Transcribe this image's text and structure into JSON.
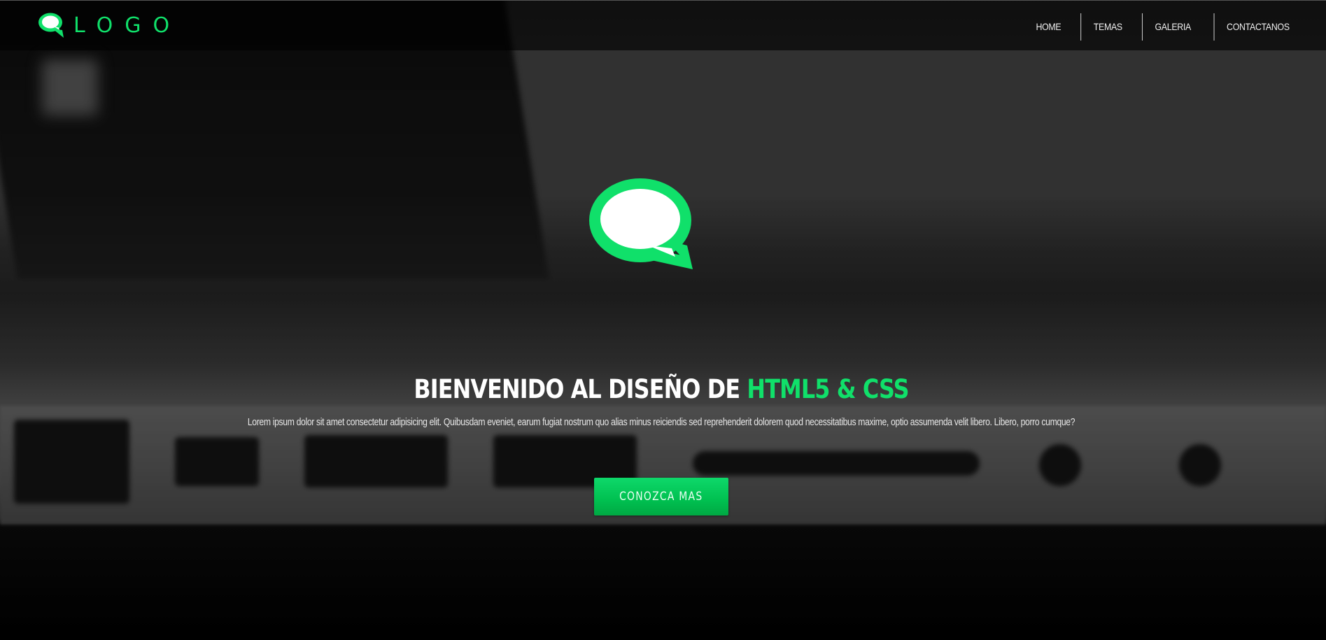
{
  "colors": {
    "accent": "#10e06a",
    "button": "#00c050",
    "header_bg": "#000000",
    "text": "#ffffff"
  },
  "header": {
    "logo_icon": "chat-bubble-icon",
    "logo_text": "LOGO",
    "nav": [
      {
        "label": "HOME"
      },
      {
        "label": "TEMAS"
      },
      {
        "label": "GALERIA"
      },
      {
        "label": "CONTACTANOS"
      }
    ]
  },
  "hero": {
    "icon": "chat-bubble-icon",
    "title_main": "BIENVENIDO AL DISEÑO DE ",
    "title_accent": "HTML5 & CSS",
    "text": "Lorem ipsum dolor sit amet consectetur adipisicing elit. Quibusdam eveniet, earum fugiat nostrum quo alias minus reiciendis sed reprehenderit dolorem quod necessitatibus maxime, optio assumenda velit libero. Libero, porro cumque?",
    "button_label": "CONOZCA MAS"
  }
}
